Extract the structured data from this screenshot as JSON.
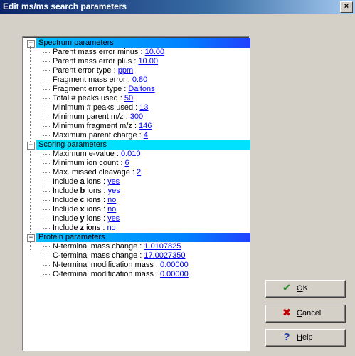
{
  "window": {
    "title": "Edit ms/ms search parameters",
    "close_label": "×"
  },
  "sections": [
    {
      "label": "Spectrum parameters",
      "params": [
        {
          "name": "Parent mass error minus : ",
          "value": "10.00"
        },
        {
          "name": "Parent mass error plus : ",
          "value": "10.00"
        },
        {
          "name": "Parent error type : ",
          "value": "ppm"
        },
        {
          "name": "Fragment mass error : ",
          "value": "0.80"
        },
        {
          "name": "Fragment error type : ",
          "value": "Daltons"
        },
        {
          "name": "Total # peaks used : ",
          "value": "50"
        },
        {
          "name": "Minimum # peaks used : ",
          "value": "13"
        },
        {
          "name": "Minimum parent m/z : ",
          "value": "300"
        },
        {
          "name": "Minimum fragment m/z : ",
          "value": "146"
        },
        {
          "name": "Maximum parent charge : ",
          "value": "4"
        }
      ]
    },
    {
      "label": "Scoring parameters",
      "params": [
        {
          "name": "Maximum e-value : ",
          "value": "0.010"
        },
        {
          "name": "Minimum ion count : ",
          "value": "6"
        },
        {
          "name": "Max. missed cleavage : ",
          "value": "2"
        },
        {
          "pre": "Include ",
          "ion": "a",
          "post": " ions : ",
          "value": "yes"
        },
        {
          "pre": "Include ",
          "ion": "b",
          "post": " ions : ",
          "value": "yes"
        },
        {
          "pre": "Include ",
          "ion": "c",
          "post": " ions : ",
          "value": "no"
        },
        {
          "pre": "Include ",
          "ion": "x",
          "post": " ions : ",
          "value": "no"
        },
        {
          "pre": "Include ",
          "ion": "y",
          "post": " ions : ",
          "value": "yes"
        },
        {
          "pre": "Include ",
          "ion": "z",
          "post": " ions : ",
          "value": "no"
        }
      ]
    },
    {
      "label": "Protein parameters",
      "params": [
        {
          "name": "N-terminal mass change : ",
          "value": "1.0107825"
        },
        {
          "name": "C-terminal mass change : ",
          "value": "17.0027350"
        },
        {
          "name": "N-terminal modification mass : ",
          "value": "0.00000"
        },
        {
          "name": "C-terminal modification mass : ",
          "value": "0.00000"
        }
      ]
    }
  ],
  "buttons": {
    "ok": {
      "mnemonic": "O",
      "rest": "K",
      "icon": "checkmark-icon",
      "color": "#2e8b2e"
    },
    "cancel": {
      "mnemonic": "C",
      "rest": "ancel",
      "icon": "x-icon",
      "color": "#c00000"
    },
    "help": {
      "mnemonic": "H",
      "rest": "elp",
      "icon": "question-icon",
      "color": "#1c3ea8"
    }
  },
  "expander_symbol": "−"
}
